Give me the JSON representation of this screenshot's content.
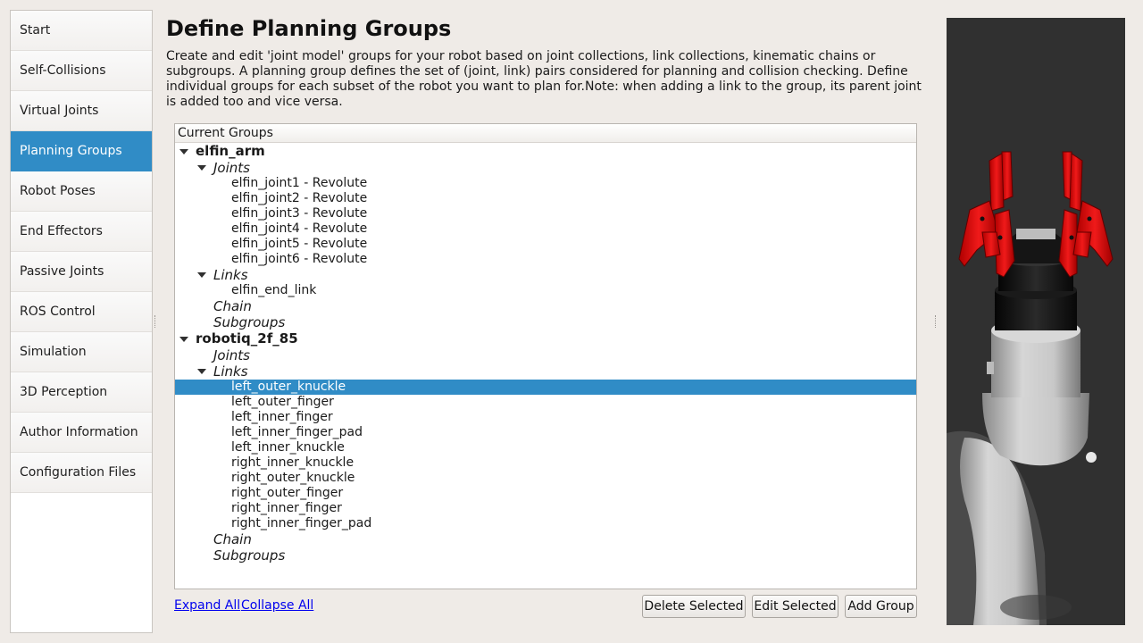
{
  "sidebar": {
    "items": [
      {
        "label": "Start",
        "active": false
      },
      {
        "label": "Self-Collisions",
        "active": false
      },
      {
        "label": "Virtual Joints",
        "active": false
      },
      {
        "label": "Planning Groups",
        "active": true
      },
      {
        "label": "Robot Poses",
        "active": false
      },
      {
        "label": "End Effectors",
        "active": false
      },
      {
        "label": "Passive Joints",
        "active": false
      },
      {
        "label": "ROS Control",
        "active": false
      },
      {
        "label": "Simulation",
        "active": false
      },
      {
        "label": "3D Perception",
        "active": false
      },
      {
        "label": "Author Information",
        "active": false
      },
      {
        "label": "Configuration Files",
        "active": false
      }
    ]
  },
  "main": {
    "title": "Define Planning Groups",
    "description": "Create and edit 'joint model' groups for your robot based on joint collections, link collections, kinematic chains or subgroups. A planning group defines the set of (joint, link) pairs considered for planning and collision checking. Define individual groups for each subset of the robot you want to plan for.Note: when adding a link to the group, its parent joint is added too and vice versa."
  },
  "tree": {
    "header": "Current Groups",
    "groups": [
      {
        "name": "elfin_arm",
        "joints_label": "Joints",
        "joints": [
          "elfin_joint1 - Revolute",
          "elfin_joint2 - Revolute",
          "elfin_joint3 - Revolute",
          "elfin_joint4 - Revolute",
          "elfin_joint5 - Revolute",
          "elfin_joint6 - Revolute"
        ],
        "links_label": "Links",
        "links": [
          "elfin_end_link"
        ],
        "chain_label": "Chain",
        "subgroups_label": "Subgroups"
      },
      {
        "name": "robotiq_2f_85",
        "joints_label": "Joints",
        "joints": [],
        "links_label": "Links",
        "links": [
          "left_outer_knuckle",
          "left_outer_finger",
          "left_inner_finger",
          "left_inner_finger_pad",
          "left_inner_knuckle",
          "right_inner_knuckle",
          "right_outer_knuckle",
          "right_outer_finger",
          "right_inner_finger",
          "right_inner_finger_pad"
        ],
        "chain_label": "Chain",
        "subgroups_label": "Subgroups"
      }
    ],
    "selected_item": "left_outer_knuckle"
  },
  "actions": {
    "expand_all": "Expand All",
    "collapse_all": "Collapse All",
    "delete_selected": "Delete Selected",
    "edit_selected": "Edit Selected",
    "add_group": "Add Group"
  },
  "colors": {
    "accent": "#308cc6",
    "gripper": "#e01010",
    "viewport_bg": "#303030"
  }
}
